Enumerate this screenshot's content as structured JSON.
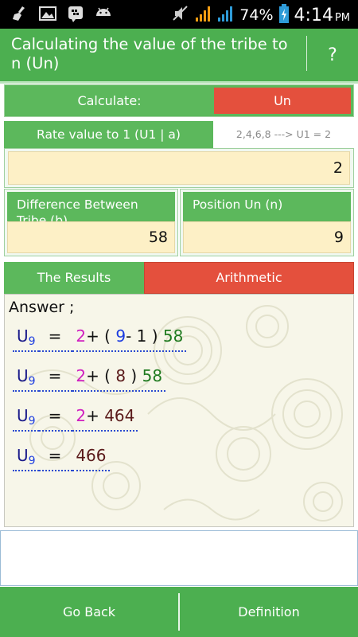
{
  "status_bar": {
    "battery_percent": "74%",
    "time": "4:14",
    "ampm": "PM",
    "icons": [
      "broom-icon",
      "image-icon",
      "bbm-icon",
      "android-icon",
      "mute-icon",
      "signal-icon",
      "wifi-signal-icon",
      "battery-charging-icon"
    ]
  },
  "titlebar": {
    "title": "Calculating the value of the tribe to n (Un)",
    "help": "?"
  },
  "calculate": {
    "label": "Calculate:",
    "value": "Un"
  },
  "rate": {
    "label": "Rate value to 1 (U1 | a)",
    "hint": "2,4,6,8 ---> U1 = 2",
    "value": "2"
  },
  "difference": {
    "label": "Difference Between Tribe (b)",
    "value": "58"
  },
  "position": {
    "label": "Position Un (n)",
    "value": "9"
  },
  "tabs": {
    "results": "The Results",
    "arithmetic": "Arithmetic"
  },
  "results": {
    "answer_label": "Answer ;",
    "equations": [
      {
        "u": "U",
        "sub": "9",
        "eq": "=",
        "parts": [
          [
            "2",
            "mag"
          ],
          [
            "+ ( ",
            "blk"
          ],
          [
            "9",
            "blu"
          ],
          [
            "- 1 ) ",
            "blk"
          ],
          [
            "58",
            "grn"
          ]
        ]
      },
      {
        "u": "U",
        "sub": "9",
        "eq": "=",
        "parts": [
          [
            "2",
            "mag"
          ],
          [
            "+ ( ",
            "blk"
          ],
          [
            "8",
            "brn"
          ],
          [
            " ) ",
            "blk"
          ],
          [
            "58",
            "grn"
          ]
        ]
      },
      {
        "u": "U",
        "sub": "9",
        "eq": "=",
        "parts": [
          [
            "2",
            "mag"
          ],
          [
            "+ ",
            "blk"
          ],
          [
            "464",
            "brn"
          ]
        ]
      },
      {
        "u": "U",
        "sub": "9",
        "eq": "=",
        "parts": [
          [
            "466",
            "brn"
          ]
        ]
      }
    ]
  },
  "bottom": {
    "back": "Go Back",
    "definition": "Definition"
  },
  "colors": {
    "green": "#4caf50",
    "red": "#e4503d",
    "input_bg": "#fdf0c6"
  }
}
